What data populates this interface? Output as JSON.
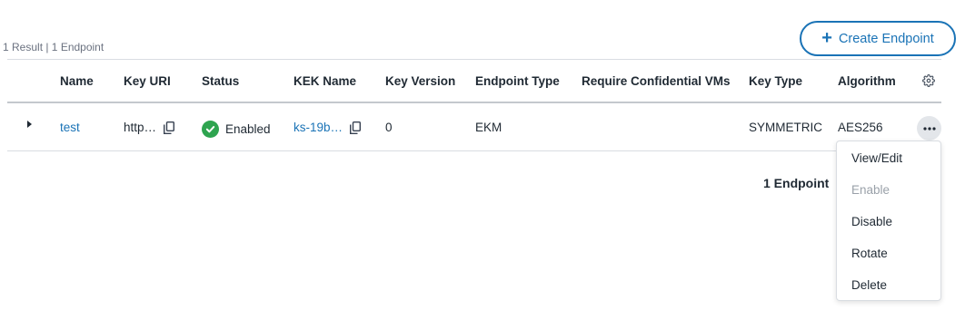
{
  "summary": "1 Result | 1 Endpoint",
  "create_button": {
    "label": "Create Endpoint",
    "icon": "plus-icon"
  },
  "columns": [
    "Name",
    "Key URI",
    "Status",
    "KEK Name",
    "Key Version",
    "Endpoint Type",
    "Require Confidential VMs",
    "Key Type",
    "Algorithm"
  ],
  "row": {
    "name": "test",
    "key_uri": "http…",
    "status": "Enabled",
    "kek_name": "ks-19b…",
    "key_version": "0",
    "endpoint_type": "EKM",
    "require_confidential_vms": "",
    "key_type": "SYMMETRIC",
    "algorithm": "AES256"
  },
  "footer": {
    "count": "1 Endpoint"
  },
  "actions_menu": [
    "View/Edit",
    "Enable",
    "Disable",
    "Rotate",
    "Delete"
  ],
  "actions_menu_disabled": [
    "Enable"
  ],
  "colors": {
    "accent": "#1a73b6",
    "status_enabled": "#2ea44f",
    "disabled_text": "#9aa1a9"
  },
  "icons": [
    "plus-icon",
    "gear-icon",
    "copy-icon",
    "check-circle-icon",
    "caret-right-icon",
    "more-horizontal-icon"
  ]
}
